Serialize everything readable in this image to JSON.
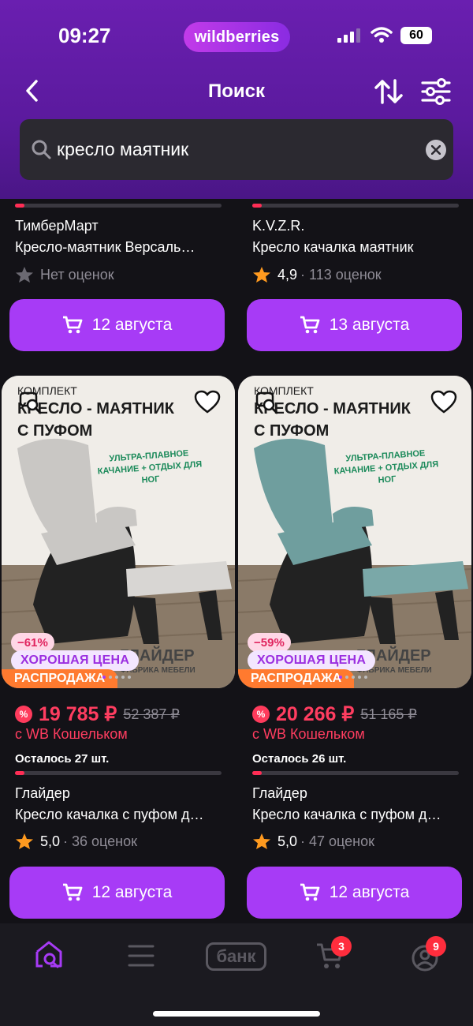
{
  "status": {
    "time": "09:27",
    "brand": "wildberries",
    "battery": "60"
  },
  "nav": {
    "title": "Поиск"
  },
  "search": {
    "value": "кресло маятник"
  },
  "top_row": [
    {
      "seller": "ТимберМарт",
      "name": "Кресло-маятник Версаль…",
      "rating": "",
      "rating_text": "Нет оценок",
      "delivery": "12 августа"
    },
    {
      "seller": "K.V.Z.R.",
      "name": "Кресло качалка маятник",
      "rating": "4,9",
      "rating_text": "· 113 оценок",
      "delivery": "13 августа"
    }
  ],
  "products": [
    {
      "image_heading_line1": "КОМПЛЕКТ",
      "image_heading_line2": "КРЕСЛО - МАЯТНИК",
      "image_heading_line3": "С ПУФОМ",
      "image_sub": "УЛЬТРА-ПЛАВНОЕ КАЧАНИЕ + ОТДЫХ ДЛЯ НОГ",
      "image_caption": "ГЛАЙДЕР",
      "image_caption2": "ФАБРИКА МЕБЕЛИ",
      "chair_color": "#c9c7c4",
      "discount": "−61%",
      "good_price": "ХОРОШАЯ ЦЕНА",
      "sale": "РАСПРОДАЖА",
      "price": "19 785 ₽",
      "old_price": "52 387 ₽",
      "wallet_note": "с WB Кошельком",
      "stock": "Осталось 27 шт.",
      "seller": "Глайдер",
      "name": "Кресло качалка с пуфом д…",
      "rating": "5,0",
      "rating_text": "· 36 оценок",
      "delivery": "12 августа"
    },
    {
      "image_heading_line1": "КОМПЛЕКТ",
      "image_heading_line2": "КРЕСЛО - МАЯТНИК",
      "image_heading_line3": "С ПУФОМ",
      "image_sub": "УЛЬТРА-ПЛАВНОЕ КАЧАНИЕ + ОТДЫХ ДЛЯ НОГ",
      "image_caption": "ГЛАЙДЕР",
      "image_caption2": "ФАБРИКА МЕБЕЛИ",
      "chair_color": "#6f9e9e",
      "discount": "−59%",
      "good_price": "ХОРОШАЯ ЦЕНА",
      "sale": "РАСПРОДАЖА",
      "price": "20 266 ₽",
      "old_price": "51 165 ₽",
      "wallet_note": "с WB Кошельком",
      "stock": "Осталось 26 шт.",
      "seller": "Глайдер",
      "name": "Кресло качалка с пуфом д…",
      "rating": "5,0",
      "rating_text": "· 47 оценок",
      "delivery": "12 августа"
    }
  ],
  "tabbar": {
    "bank_label": "банк",
    "cart_count": "3",
    "profile_count": "9"
  },
  "colors": {
    "accent": "#a73bf6",
    "price": "#ff3d60",
    "header": "#5b1a9e",
    "sale": "#ff7a2f"
  }
}
